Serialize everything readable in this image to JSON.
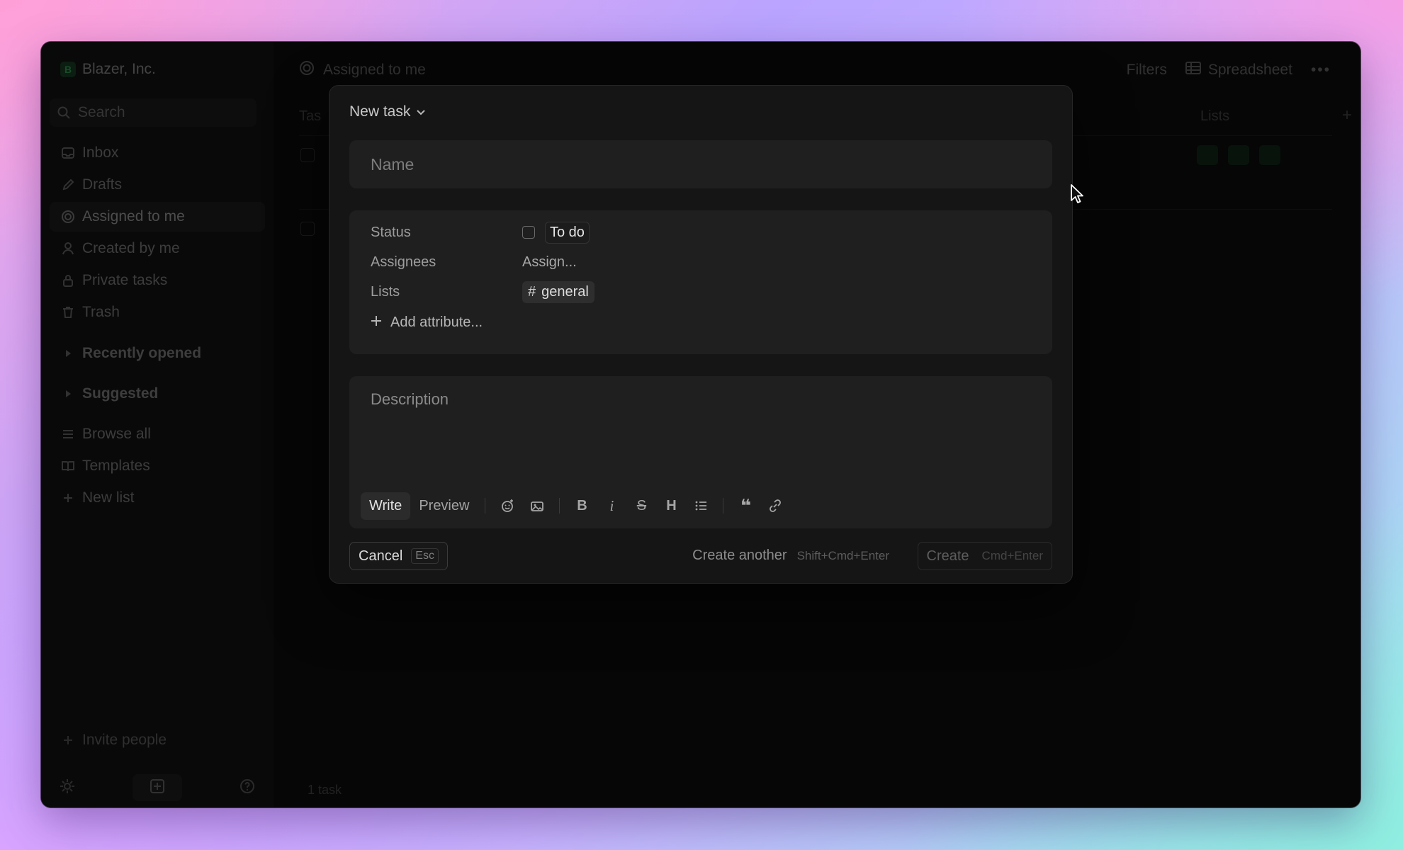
{
  "sidebar": {
    "workspace_initial": "B",
    "workspace_name": "Blazer, Inc.",
    "search_placeholder": "Search",
    "items": [
      {
        "label": "Inbox",
        "icon": "inbox-icon"
      },
      {
        "label": "Drafts",
        "icon": "pencil-icon"
      },
      {
        "label": "Assigned to me",
        "icon": "target-icon",
        "active": true
      },
      {
        "label": "Created by me",
        "icon": "user-icon"
      },
      {
        "label": "Private tasks",
        "icon": "lock-icon"
      },
      {
        "label": "Trash",
        "icon": "trash-icon"
      }
    ],
    "sections": [
      {
        "label": "Recently opened"
      },
      {
        "label": "Suggested"
      }
    ],
    "links": [
      {
        "label": "Browse all",
        "icon": "list-icon"
      },
      {
        "label": "Templates",
        "icon": "book-icon"
      },
      {
        "label": "New list",
        "icon": "plus-icon"
      }
    ],
    "invite_label": "Invite people"
  },
  "main": {
    "title": "Assigned to me",
    "filters_label": "Filters",
    "view_label": "Spreadsheet",
    "col_task": "Tas",
    "col_lists": "Lists",
    "task_count": "1 task"
  },
  "modal": {
    "title": "New task",
    "name_placeholder": "Name",
    "attributes": {
      "status_label": "Status",
      "status_value": "To do",
      "assignees_label": "Assignees",
      "assignees_value": "Assign...",
      "lists_label": "Lists",
      "lists_value": "general",
      "add_attribute": "Add attribute..."
    },
    "description_placeholder": "Description",
    "toolbar": {
      "write_tab": "Write",
      "preview_tab": "Preview",
      "buttons": [
        "emoji-icon",
        "image-icon",
        "bold-icon",
        "italic-icon",
        "strikethrough-icon",
        "heading-icon",
        "bullet-list-icon",
        "quote-icon",
        "link-icon"
      ]
    },
    "footer": {
      "cancel_label": "Cancel",
      "cancel_hint": "Esc",
      "create_another_label": "Create another",
      "create_another_hint": "Shift+Cmd+Enter",
      "create_label": "Create",
      "create_hint": "Cmd+Enter"
    }
  },
  "colors": {
    "window_bg": "#0b0b0b",
    "sidebar_bg": "#111111",
    "modal_bg": "#151515",
    "panel_bg": "#1f1f1f",
    "workspace_badge": "#16351f"
  }
}
